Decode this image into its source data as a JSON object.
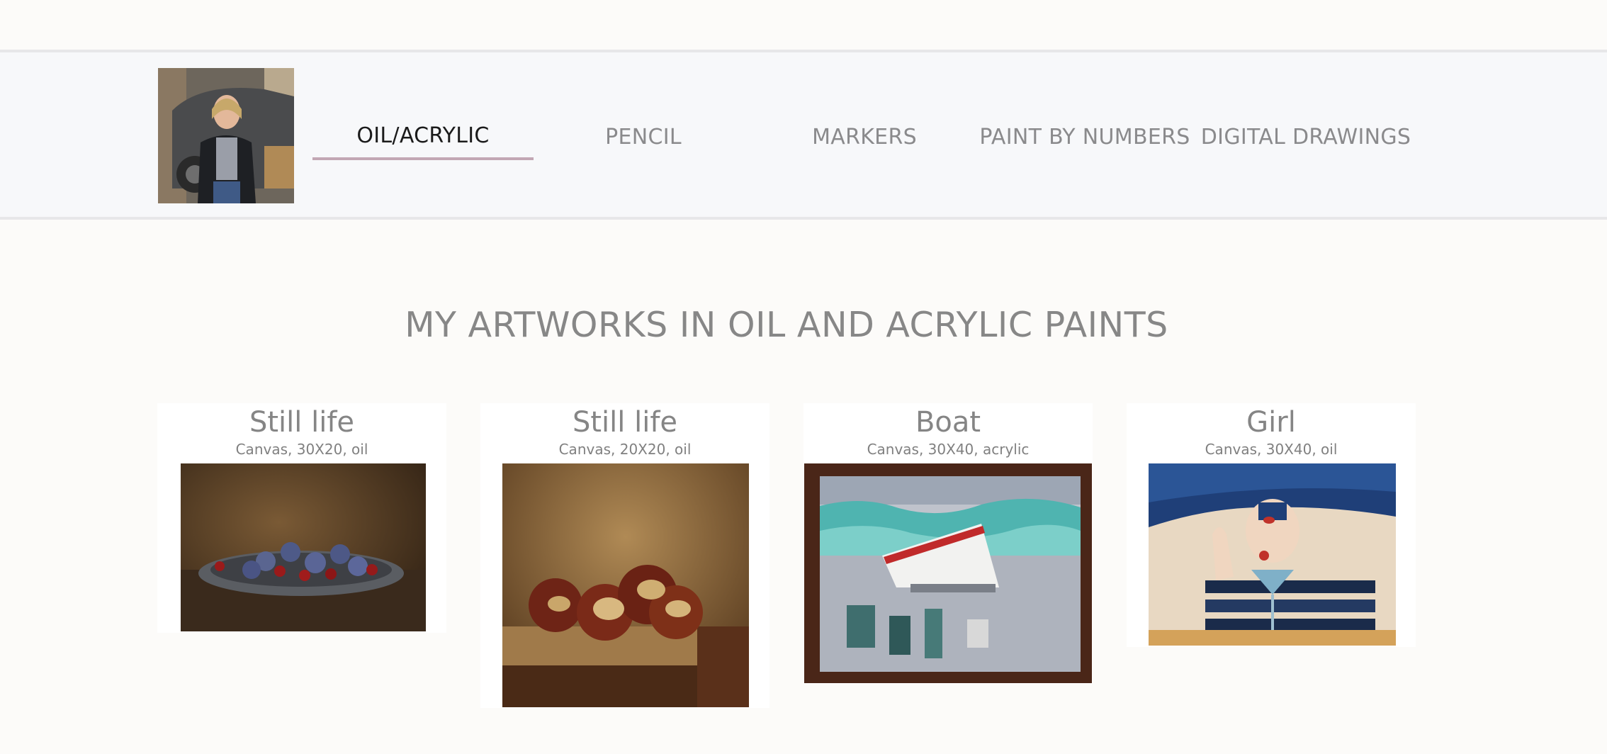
{
  "nav": {
    "items": [
      {
        "label": "OIL/ACRYLIC",
        "active": true
      },
      {
        "label": "PENCIL",
        "active": false
      },
      {
        "label": "MARKERS",
        "active": false
      },
      {
        "label": "PAINT BY NUMBERS",
        "active": false
      },
      {
        "label": "DIGITAL DRAWINGS",
        "active": false
      }
    ],
    "accent_color": "#c2a7b4"
  },
  "main": {
    "title": "MY ARTWORKS IN OIL AND ACRYLIC PAINTS",
    "artworks": [
      {
        "title": "Still life",
        "details": "Canvas, 30X20, oil"
      },
      {
        "title": "Still life",
        "details": "Canvas, 20X20, oil"
      },
      {
        "title": "Boat",
        "details": "Canvas, 30X40, acrylic"
      },
      {
        "title": "Girl",
        "details": "Canvas, 30X40, oil"
      }
    ]
  }
}
